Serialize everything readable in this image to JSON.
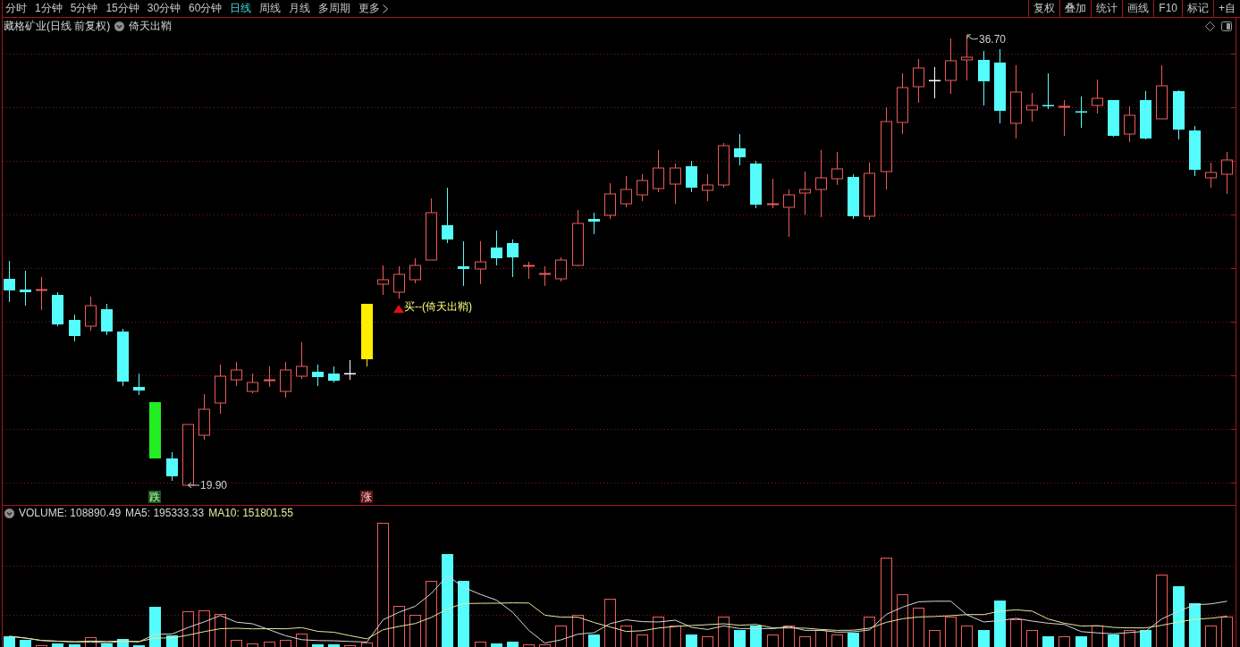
{
  "toolbar": {
    "periods": [
      {
        "label": "分时",
        "selected": false
      },
      {
        "label": "1分钟",
        "selected": false
      },
      {
        "label": "5分钟",
        "selected": false
      },
      {
        "label": "15分钟",
        "selected": false
      },
      {
        "label": "30分钟",
        "selected": false
      },
      {
        "label": "60分钟",
        "selected": false
      },
      {
        "label": "日线",
        "selected": true
      },
      {
        "label": "周线",
        "selected": false
      },
      {
        "label": "月线",
        "selected": false
      },
      {
        "label": "多周期",
        "selected": false
      }
    ],
    "more": {
      "label": "更多"
    },
    "actions": [
      "复权",
      "叠加",
      "统计",
      "画线",
      "F10",
      "标记",
      "+自"
    ]
  },
  "chart_header": {
    "title": "藏格矿业(日线 前复权)",
    "indicator": "倚天出鞘"
  },
  "price_chart": {
    "extremes": [
      {
        "kind": "high",
        "label": "36.70"
      },
      {
        "kind": "low",
        "label": "19.90"
      }
    ],
    "signals": [
      {
        "kind": "buy",
        "label": "买--(倚天出鞘)"
      }
    ],
    "markers": [
      {
        "kind": "fall",
        "label": "跌"
      },
      {
        "kind": "rise",
        "label": "涨"
      }
    ]
  },
  "volume_panel": {
    "readings": [
      {
        "text": "VOLUME: 108890.49",
        "color": "#d8d8d8"
      },
      {
        "text": "MA5: 195333.33",
        "color": "#d8d8d8"
      },
      {
        "text": "MA10: 151801.55",
        "color": "#e8e8a0"
      }
    ]
  }
}
